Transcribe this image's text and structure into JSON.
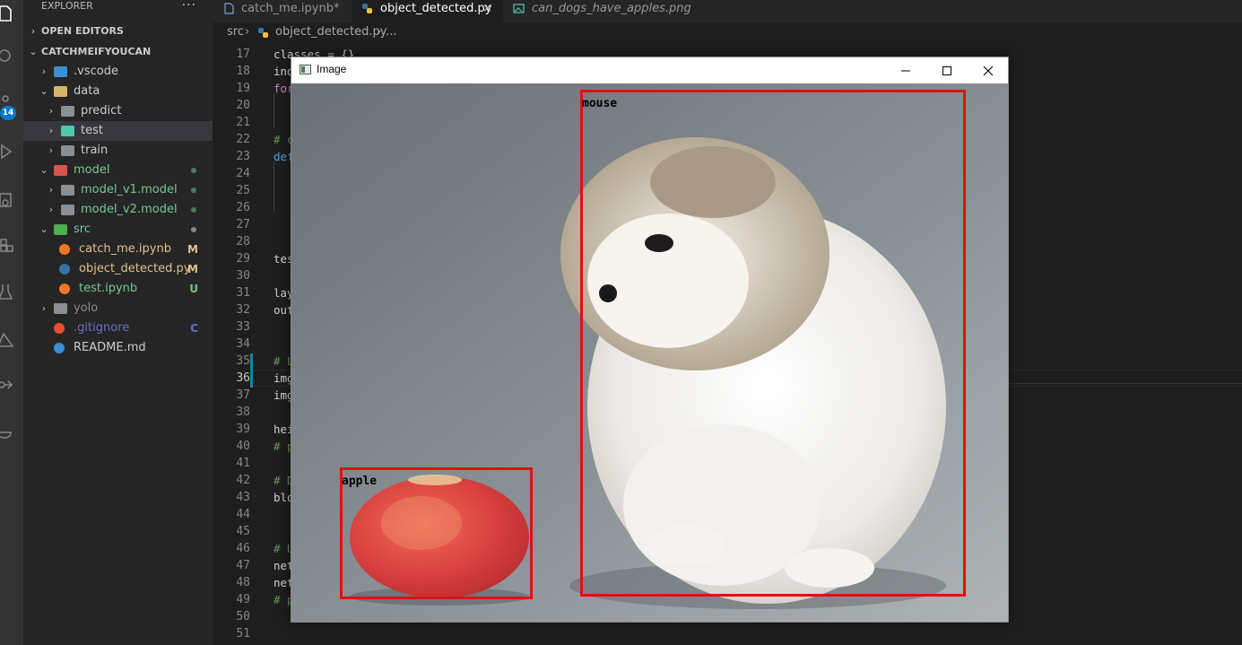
{
  "activity_bar": {
    "icons": [
      "files-icon",
      "search-icon",
      "source-control-icon",
      "run-debug-icon",
      "remote-explorer-icon",
      "extensions-icon",
      "testing-icon",
      "azure-icon",
      "git-graph-icon",
      "docker-icon"
    ],
    "source_control_badge": "14",
    "accent": "#007acc"
  },
  "sidebar": {
    "title": "EXPLORER",
    "more_actions": "···",
    "open_editors": "OPEN EDITORS",
    "workspace": "CATCHMEIFYOUCAN",
    "tree": [
      {
        "name": ".vscode",
        "type": "folder",
        "expanded": false,
        "color": "#cccccc",
        "icon": "vscode-folder-icon"
      },
      {
        "name": "data",
        "type": "folder",
        "expanded": true,
        "color": "#cccccc",
        "icon": "folder-open-icon"
      },
      {
        "name": "predict",
        "type": "folder",
        "expanded": false,
        "color": "#cccccc",
        "icon": "folder-icon"
      },
      {
        "name": "test",
        "type": "folder",
        "expanded": false,
        "color": "#cccccc",
        "icon": "test-folder-icon",
        "selected": true
      },
      {
        "name": "train",
        "type": "folder",
        "expanded": false,
        "color": "#cccccc",
        "icon": "folder-icon"
      },
      {
        "name": "model",
        "type": "folder",
        "expanded": true,
        "color": "#73c991",
        "icon": "model-folder-icon",
        "dot": true
      },
      {
        "name": "model_v1.model",
        "type": "folder",
        "expanded": false,
        "color": "#73c991",
        "icon": "folder-icon",
        "dot": true
      },
      {
        "name": "model_v2.model",
        "type": "folder",
        "expanded": false,
        "color": "#73c991",
        "icon": "folder-icon",
        "dot": true
      },
      {
        "name": "src",
        "type": "folder",
        "expanded": true,
        "color": "#73c991",
        "icon": "src-folder-icon",
        "dot": true,
        "dot_color": "#888888"
      },
      {
        "name": "catch_me.ipynb",
        "type": "file",
        "color": "#e2c08d",
        "icon": "jupyter-icon",
        "decoration": "M"
      },
      {
        "name": "object_detected.py",
        "type": "file",
        "color": "#e2c08d",
        "icon": "python-icon",
        "decoration": "M"
      },
      {
        "name": "test.ipynb",
        "type": "file",
        "color": "#73c991",
        "icon": "jupyter-icon",
        "decoration": "U"
      },
      {
        "name": "yolo",
        "type": "folder",
        "expanded": false,
        "color": "#8c8c8c",
        "icon": "folder-icon"
      },
      {
        "name": ".gitignore",
        "type": "file",
        "color": "#6c6cc4",
        "icon": "git-icon",
        "decoration": "C"
      },
      {
        "name": "README.md",
        "type": "file",
        "color": "#cccccc",
        "icon": "info-icon"
      }
    ]
  },
  "tabs": [
    {
      "label": "catch_me.ipynb*",
      "icon": "file-icon",
      "active": false
    },
    {
      "label": "object_detected.py",
      "icon": "python-icon",
      "active": true,
      "close": "×"
    },
    {
      "label": "can_dogs_have_apples.png",
      "icon": "image-icon",
      "active": false
    }
  ],
  "breadcrumb": {
    "root": "src",
    "file": "object_detected.py",
    "more": "..."
  },
  "editor": {
    "current_line": 36,
    "lines": [
      {
        "n": 17,
        "code": "classes = {}"
      },
      {
        "n": 18,
        "code": "ind"
      },
      {
        "n": 19,
        "code": "for"
      },
      {
        "n": 20,
        "code": ""
      },
      {
        "n": 21,
        "code": ""
      },
      {
        "n": 22,
        "code": "# c"
      },
      {
        "n": 23,
        "code": "def"
      },
      {
        "n": 24,
        "code": ""
      },
      {
        "n": 25,
        "code": ""
      },
      {
        "n": 26,
        "code": ""
      },
      {
        "n": 27,
        "code": ""
      },
      {
        "n": 28,
        "code": ""
      },
      {
        "n": 29,
        "code": "tes"
      },
      {
        "n": 30,
        "code": ""
      },
      {
        "n": 31,
        "code": "lay"
      },
      {
        "n": 32,
        "code": "out"
      },
      {
        "n": 33,
        "code": ""
      },
      {
        "n": 34,
        "code": ""
      },
      {
        "n": 35,
        "code": "# L"
      },
      {
        "n": 36,
        "code": "img"
      },
      {
        "n": 37,
        "code": "img"
      },
      {
        "n": 38,
        "code": ""
      },
      {
        "n": 39,
        "code": "hei"
      },
      {
        "n": 40,
        "code": "# p"
      },
      {
        "n": 41,
        "code": ""
      },
      {
        "n": 42,
        "code": "# D"
      },
      {
        "n": 43,
        "code": "blo"
      },
      {
        "n": 44,
        "code": ""
      },
      {
        "n": 45,
        "code": ""
      },
      {
        "n": 46,
        "code": "# U"
      },
      {
        "n": 47,
        "code": "net"
      },
      {
        "n": 48,
        "code": "net"
      },
      {
        "n": 49,
        "code": "# p"
      },
      {
        "n": 50,
        "code": ""
      },
      {
        "n": 51,
        "code": ""
      }
    ]
  },
  "image_window": {
    "title": "Image",
    "controls": [
      "minimize-icon",
      "maximize-icon",
      "close-icon"
    ],
    "detections": [
      {
        "label": "mouse",
        "color": "#e01010"
      },
      {
        "label": "apple",
        "color": "#e01010"
      }
    ]
  }
}
